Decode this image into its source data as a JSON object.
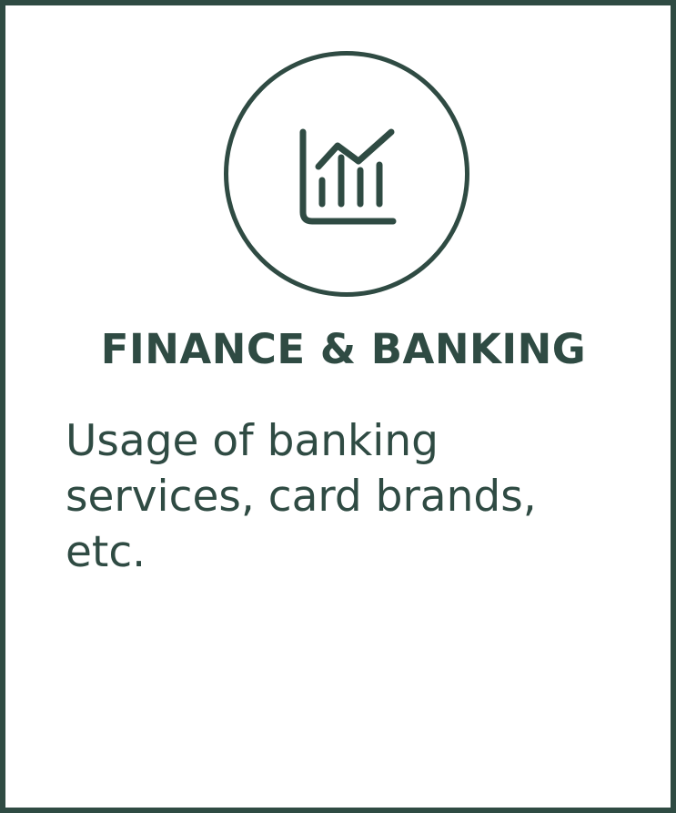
{
  "card": {
    "icon": "chart-growth-icon",
    "title": "FINANCE & BANKING",
    "description_lines": [
      "Usage of banking",
      "services, card brands,",
      "etc."
    ]
  },
  "colors": {
    "primary": "#2f4b43",
    "background": "#ffffff"
  }
}
